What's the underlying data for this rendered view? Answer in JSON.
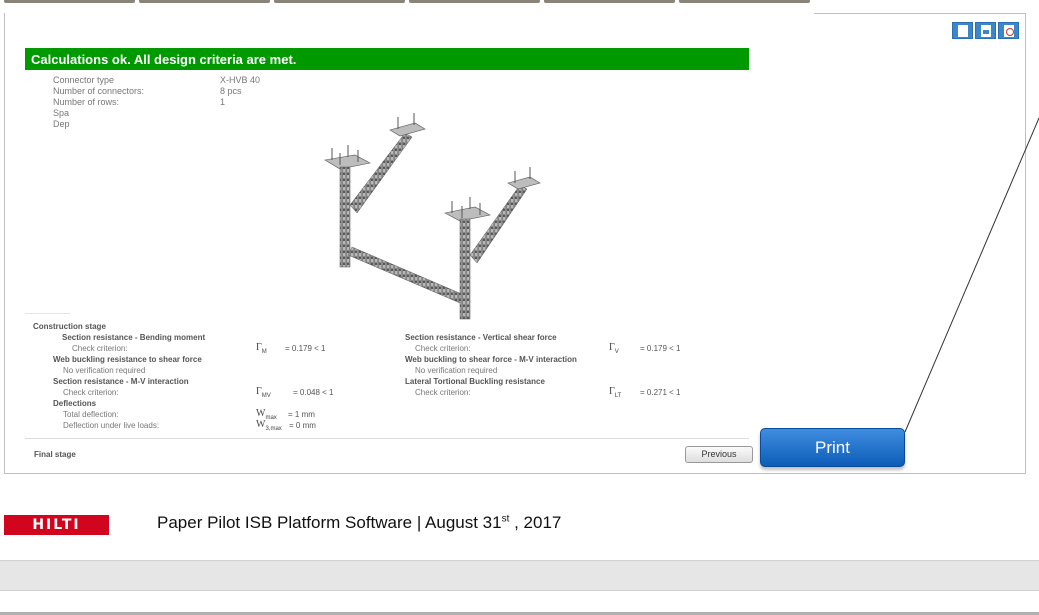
{
  "banner": {
    "text": "Calculations ok. All design criteria are met."
  },
  "properties": [
    {
      "label": "Connector type",
      "value": "X-HVB 40"
    },
    {
      "label": "Number of connectors:",
      "value": "8 pcs"
    },
    {
      "label": "Number of rows:",
      "value": "1"
    },
    {
      "label": "Spa",
      "value": ""
    },
    {
      "label": "Dep",
      "value": ""
    }
  ],
  "construction_stage": {
    "title": "Construction stage",
    "left": [
      {
        "kind": "h",
        "text": "Section resistance - Bending moment"
      },
      {
        "kind": "n",
        "text": "Check criterion:",
        "sym": "Γ",
        "sub": "M",
        "value": "= 0.179 < 1"
      },
      {
        "kind": "h",
        "text": "Web buckling resistance to shear force"
      },
      {
        "kind": "n",
        "text": "No verification required"
      },
      {
        "kind": "h",
        "text": "Section resistance - M-V interaction"
      },
      {
        "kind": "n",
        "text": "Check criterion:",
        "sym": "Γ",
        "sub": "MV",
        "value": "= 0.048 < 1"
      },
      {
        "kind": "h",
        "text": "Deflections"
      },
      {
        "kind": "n",
        "text": "Total deflection:",
        "sym": "W",
        "sub": "max",
        "value": "= 1 mm"
      },
      {
        "kind": "n",
        "text": "Deflection under live loads:",
        "sym": "W",
        "sub": "3,max",
        "value": "= 0 mm"
      }
    ],
    "right": [
      {
        "kind": "h",
        "text": "Section resistance - Vertical shear force"
      },
      {
        "kind": "n",
        "text": "Check criterion:",
        "sym": "Γ",
        "sub": "V",
        "value": "= 0.179 < 1"
      },
      {
        "kind": "h",
        "text": "Web buckling to shear force - M-V interaction"
      },
      {
        "kind": "n",
        "text": "No verification required"
      },
      {
        "kind": "h",
        "text": "Lateral Tortional Buckling resistance"
      },
      {
        "kind": "n",
        "text": "Check criterion:",
        "sym": "Γ",
        "sub": "LT",
        "value": "= 0.271 < 1"
      }
    ]
  },
  "final_stage": {
    "title": "Final stage"
  },
  "buttons": {
    "previous": "Previous",
    "print": "Print"
  },
  "export_icons": [
    "document-icon",
    "image-icon",
    "pdf-icon"
  ],
  "footer": {
    "logo": "HILTI",
    "text_main": "Paper Pilot ISB Platform Software | August 31",
    "text_sup": "st",
    "text_end": " , 2017"
  },
  "colors": {
    "banner": "#009a00",
    "print_button": "#1a6fd0",
    "logo": "#d2051e"
  }
}
